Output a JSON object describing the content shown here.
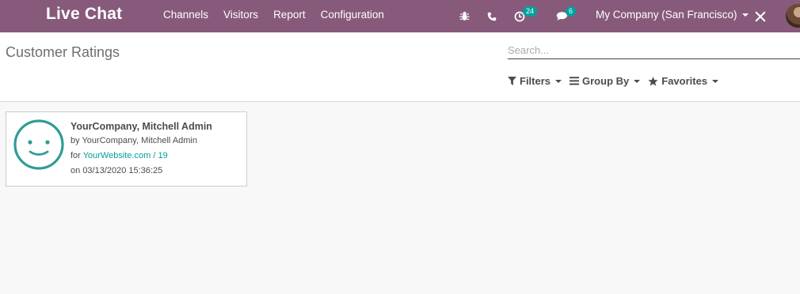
{
  "navbar": {
    "app_title": "Live Chat",
    "menu": [
      "Channels",
      "Visitors",
      "Report",
      "Configuration"
    ],
    "activity_count": "24",
    "messages_count": "6",
    "company": "My Company (San Francisco)",
    "colors": {
      "background": "#875a7b",
      "badge": "#00a09d"
    }
  },
  "control_panel": {
    "breadcrumb": "Customer Ratings",
    "search_placeholder": "Search...",
    "filters_label": "Filters",
    "group_by_label": "Group By",
    "favorites_label": "Favorites"
  },
  "rating_card": {
    "rating_icon": "smile-face-icon",
    "partner": "YourCompany, Mitchell Admin",
    "by_prefix": "by",
    "rated_by": "YourCompany, Mitchell Admin",
    "for_prefix": "for",
    "resource": "YourWebsite.com / 19",
    "on_prefix": "on",
    "date": "03/13/2020 15:36:25",
    "colors": {
      "face": "#2f9d95",
      "link": "#00a09d"
    }
  }
}
